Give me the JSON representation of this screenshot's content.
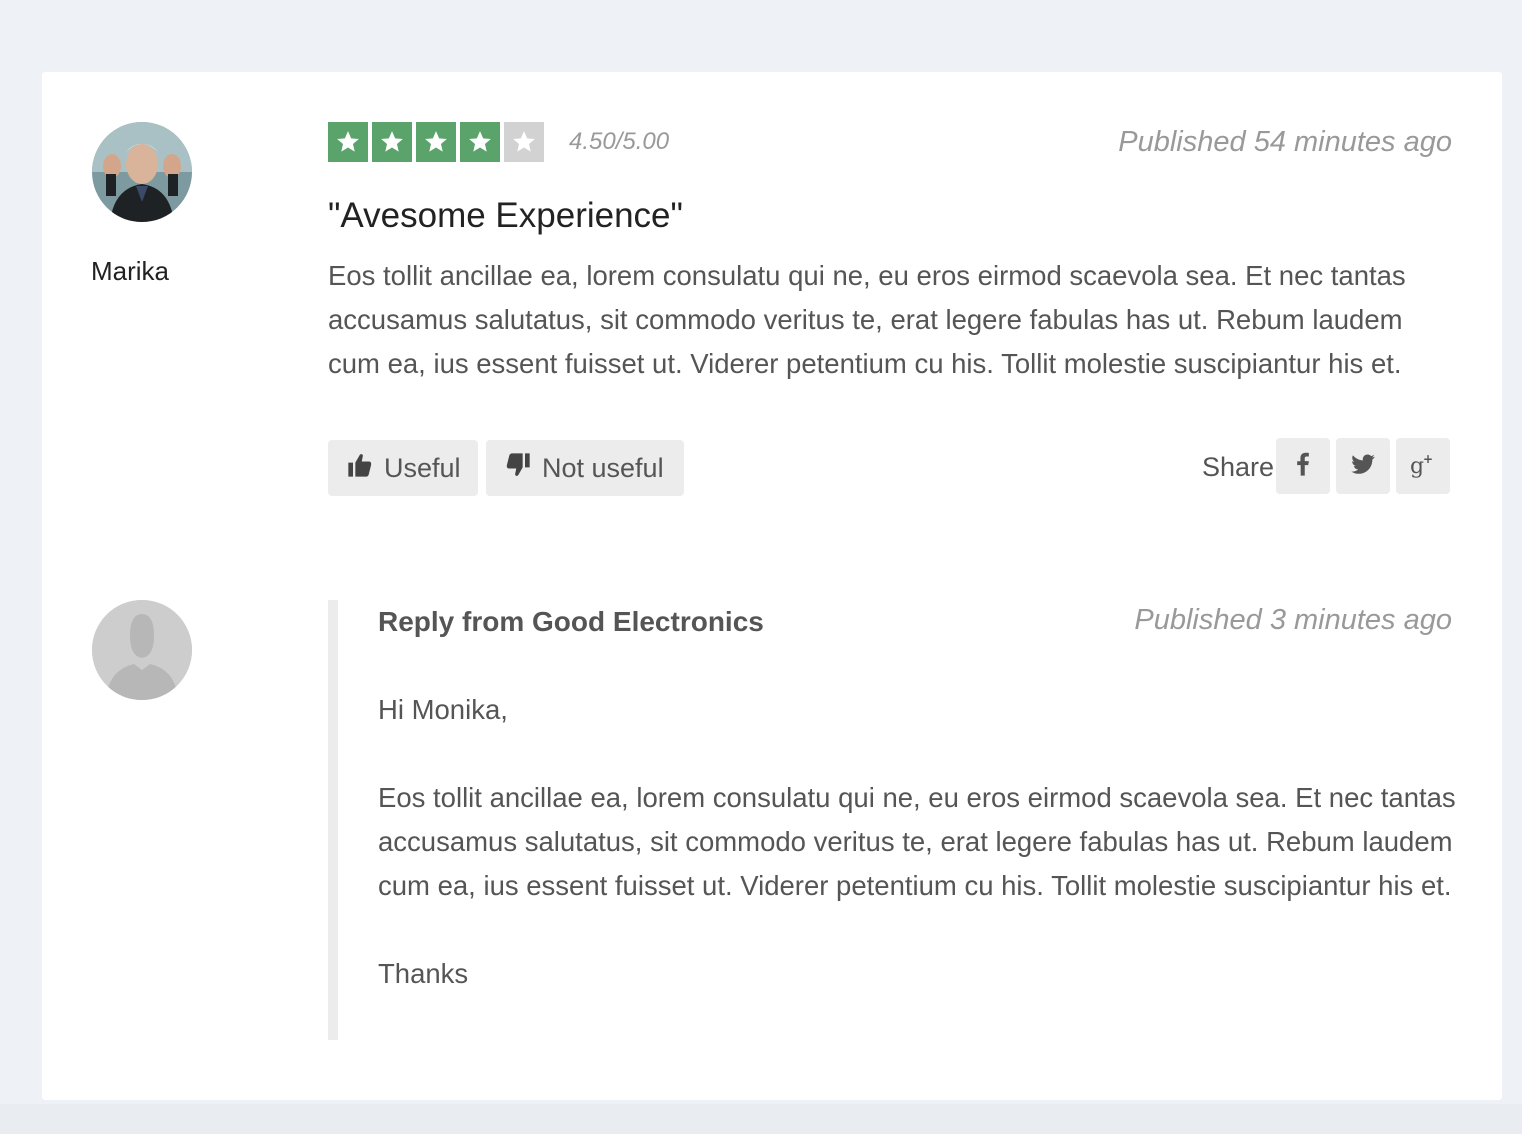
{
  "review": {
    "reviewer_name": "Marika",
    "rating": {
      "value": 4.5,
      "max": 5,
      "filled_stars": 4,
      "total_stars": 5,
      "text": "4.50/5.00"
    },
    "published": "Published 54 minutes ago",
    "title": "\"Avesome Experience\"",
    "body": "Eos tollit ancillae ea, lorem consulatu qui ne, eu eros eirmod scaevola sea. Et nec tantas accusamus salutatus, sit commodo veritus te, erat legere fabulas has ut. Rebum laudem cum ea, ius essent fuisset ut. Viderer petentium cu his. Tollit molestie suscipiantur his et.",
    "actions": {
      "useful_label": "Useful",
      "not_useful_label": "Not useful"
    },
    "share": {
      "label": "Share",
      "networks": [
        "facebook-icon",
        "twitter-icon",
        "google-plus-icon"
      ]
    }
  },
  "reply": {
    "title": "Reply from Good Electronics",
    "published": "Published 3 minutes ago",
    "paragraphs": [
      "Hi Monika,",
      "Eos tollit ancillae ea, lorem consulatu qui ne, eu eros eirmod scaevola sea. Et nec tantas accusamus salutatus, sit commodo veritus te, erat legere fabulas has ut. Rebum laudem cum ea, ius essent fuisset ut. Viderer petentium cu his. Tollit molestie suscipiantur his et.",
      "Thanks"
    ]
  },
  "colors": {
    "star_filled": "#5aa36b",
    "star_empty": "#d2d2d2",
    "background": "#eef1f6",
    "button_bg": "#ececec"
  }
}
